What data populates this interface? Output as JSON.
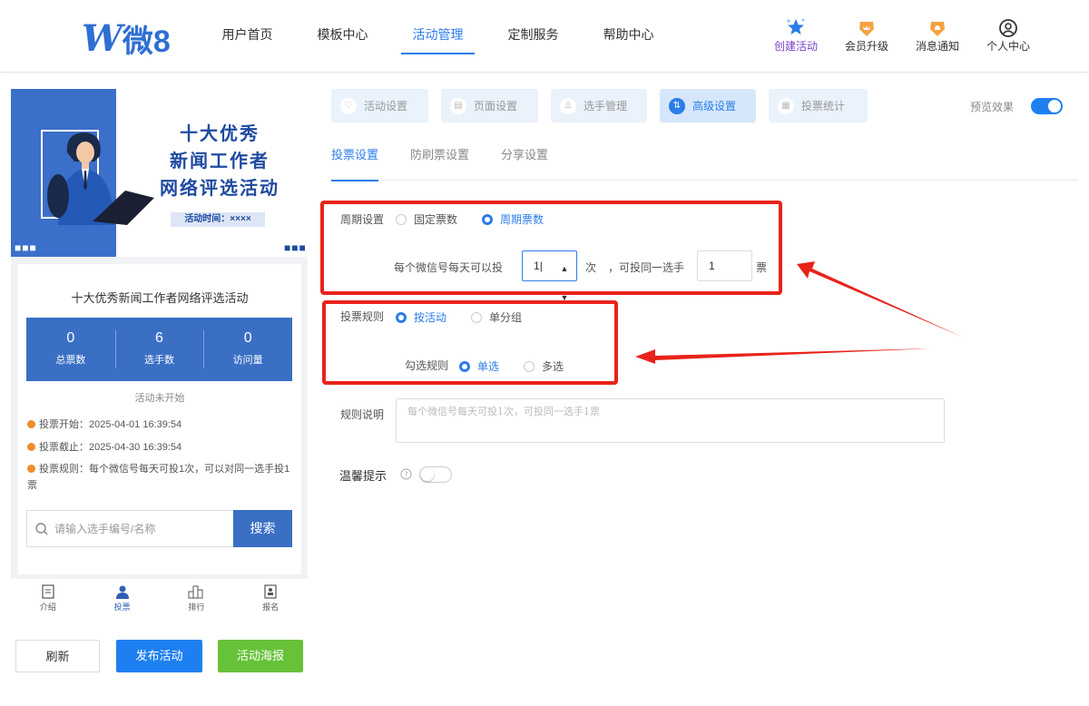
{
  "brand": {
    "logo_mark": "W",
    "logo_text": "微8"
  },
  "nav": [
    "用户首页",
    "模板中心",
    "活动管理",
    "定制服务",
    "帮助中心"
  ],
  "nav_active_index": 2,
  "header_actions": [
    {
      "label": "创建活动",
      "icon": "star-icon"
    },
    {
      "label": "会员升级",
      "icon": "crown-icon"
    },
    {
      "label": "消息通知",
      "icon": "bell-icon"
    },
    {
      "label": "个人中心",
      "icon": "user-icon"
    }
  ],
  "preview": {
    "banner_title": [
      "十大优秀",
      "新闻工作者",
      "网络评选活动"
    ],
    "banner_time": "活动时间：××××",
    "card_title": "十大优秀新闻工作者网络评选活动",
    "stats": [
      {
        "value": "0",
        "label": "总票数"
      },
      {
        "value": "6",
        "label": "选手数"
      },
      {
        "value": "0",
        "label": "访问量"
      }
    ],
    "status": "活动未开始",
    "vote_start": "投票开始：2025-04-01 16:39:54",
    "vote_end": "投票截止：2025-04-30 16:39:54",
    "vote_rule": "投票规则：每个微信号每天可投1次，可以对同一选手投1票",
    "search_placeholder": "请输入选手编号/名称",
    "search_button": "搜索",
    "tabs": [
      "介绍",
      "投票",
      "排行",
      "报名"
    ],
    "active_tab": 1
  },
  "buttons": {
    "refresh": "刷新",
    "publish": "发布活动",
    "poster": "活动海报"
  },
  "steps": [
    "活动设置",
    "页面设置",
    "选手管理",
    "高级设置",
    "投票统计"
  ],
  "active_step": 3,
  "preview_effect_label": "预览效果",
  "subtabs": [
    "投票设置",
    "防刷票设置",
    "分享设置"
  ],
  "form": {
    "period_label": "周期设置",
    "period_options": [
      "固定票数",
      "周期票数"
    ],
    "period_selected": 1,
    "daily_label": "每个微信号每天可以投",
    "daily_value": "1",
    "times_unit": "次",
    "same_player_label": "，可投同一选手",
    "same_player_value": "1",
    "ticket_unit": "票",
    "rule_label": "投票规则",
    "rule_options": [
      "按活动",
      "单分组"
    ],
    "rule_selected": 0,
    "check_label": "勾选规则",
    "check_options": [
      "单选",
      "多选"
    ],
    "check_selected": 0,
    "desc_label": "规则说明",
    "desc_placeholder": "每个微信号每天可投1次，可投同一选手1票",
    "tip_label": "温馨提示"
  },
  "colors": {
    "accent": "#2b7de9",
    "brand_blue": "#3a6fc4",
    "green": "#67c23a",
    "red_annotation": "#e8231b"
  }
}
